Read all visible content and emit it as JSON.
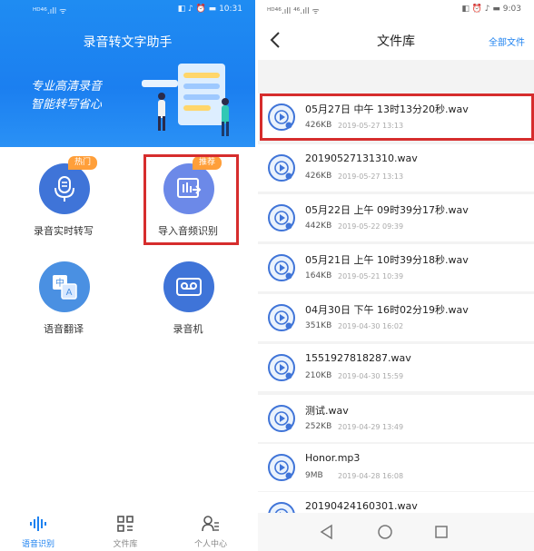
{
  "left": {
    "status": {
      "signal": "ᴴᴰ⁴⁶.ıll ᯤ",
      "icons": "◧ ♪ ⏰ ▬",
      "time": "10:31"
    },
    "app_title": "录音转文字助手",
    "slogan_line1": "专业高清录音",
    "slogan_line2": "智能转写省心",
    "features": [
      {
        "label": "录音实时转写",
        "badge": "热门",
        "icon": "microphone-icon"
      },
      {
        "label": "导入音频识别",
        "badge": "推荐",
        "icon": "audio-import-icon"
      },
      {
        "label": "语音翻译",
        "badge": "",
        "icon": "translate-icon"
      },
      {
        "label": "录音机",
        "badge": "",
        "icon": "cassette-icon"
      }
    ],
    "tabs": [
      {
        "label": "语音识别",
        "icon": "waveform-icon"
      },
      {
        "label": "文件库",
        "icon": "grid-icon"
      },
      {
        "label": "个人中心",
        "icon": "user-icon"
      }
    ]
  },
  "right": {
    "status": {
      "signal": "ᴴᴰ⁴⁶.ıll ⁴⁶.ıll ᯤ",
      "icons": "◧ ⏰ ♪ ▬",
      "time": "9:03"
    },
    "title": "文件库",
    "filter_label": "全部文件",
    "files": [
      {
        "name": "05月27日 中午 13时13分20秒.wav",
        "size": "426KB",
        "date": "2019-05-27 13:13"
      },
      {
        "name": "20190527131310.wav",
        "size": "426KB",
        "date": "2019-05-27 13:13"
      },
      {
        "name": "05月22日 上午 09时39分17秒.wav",
        "size": "442KB",
        "date": "2019-05-22 09:39"
      },
      {
        "name": "05月21日 上午 10时39分18秒.wav",
        "size": "164KB",
        "date": "2019-05-21 10:39"
      },
      {
        "name": "04月30日 下午 16时02分19秒.wav",
        "size": "351KB",
        "date": "2019-04-30 16:02"
      },
      {
        "name": "1551927818287.wav",
        "size": "210KB",
        "date": "2019-04-30 15:59"
      },
      {
        "name": "测试.wav",
        "size": "252KB",
        "date": "2019-04-29 13:49"
      },
      {
        "name": "Honor.mp3",
        "size": "9MB",
        "date": "2019-04-28 16:08"
      },
      {
        "name": "20190424160301.wav",
        "size": "",
        "date": ""
      }
    ]
  },
  "colors": {
    "primary": "#1e82f0",
    "badge": "#ff9f3a",
    "highlight": "#d62d2d"
  }
}
